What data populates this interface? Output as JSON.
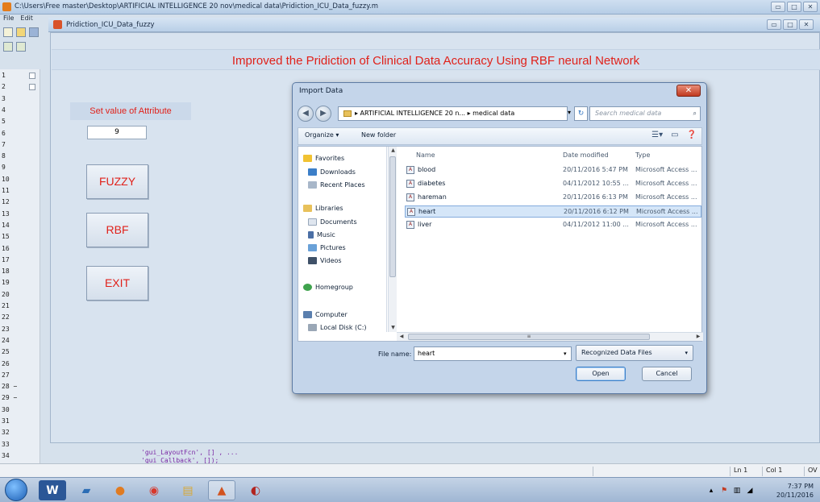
{
  "editor": {
    "title": "C:\\Users\\Free master\\Desktop\\ARTIFICIAL INTELLIGENCE 20 nov\\medical data\\Pridiction_ICU_Data_fuzzy.m",
    "menu": [
      "File",
      "Edit"
    ],
    "line_numbers": [
      "1",
      "2",
      "3",
      "4",
      "5",
      "6",
      "7",
      "8",
      "9",
      "10",
      "11",
      "12",
      "13",
      "14",
      "15",
      "16",
      "17",
      "18",
      "19",
      "20",
      "21",
      "22",
      "23",
      "24",
      "25",
      "26",
      "27",
      "28 −",
      "29 −",
      "30",
      "31",
      "32",
      "33",
      "34"
    ],
    "code_lines": [
      "'gui_LayoutFcn',  [] , ...",
      "'gui_Callback',   []);"
    ],
    "status": {
      "ln": "Ln 1",
      "col": "Col 1",
      "ovr": "OV"
    }
  },
  "gui": {
    "window_title": "Pridiction_ICU_Data_fuzzy",
    "heading": "Improved the Pridiction of Clinical Data Accuracy Using RBF neural Network",
    "attribute_label": "Set value of Attribute",
    "attribute_value": "9",
    "buttons": {
      "fuzzy": "FUZZY",
      "rbf": "RBF",
      "exit": "EXIT"
    }
  },
  "dialog": {
    "title": "Import Data",
    "address": "▸ ARTIFICIAL INTELLIGENCE 20 n... ▸ medical data",
    "search_placeholder": "Search medical data",
    "organize": "Organize ▾",
    "new_folder": "New folder",
    "nav": {
      "favorites": "Favorites",
      "downloads": "Downloads",
      "recent": "Recent Places",
      "libraries": "Libraries",
      "documents": "Documents",
      "music": "Music",
      "pictures": "Pictures",
      "videos": "Videos",
      "homegroup": "Homegroup",
      "computer": "Computer",
      "local_disk": "Local Disk (C:)"
    },
    "columns": {
      "name": "Name",
      "date": "Date modified",
      "type": "Type"
    },
    "files": [
      {
        "name": "blood",
        "date": "20/11/2016 5:47 PM",
        "type": "Microsoft Access ..."
      },
      {
        "name": "diabetes",
        "date": "04/11/2012 10:55 ...",
        "type": "Microsoft Access ..."
      },
      {
        "name": "hareman",
        "date": "20/11/2016 6:13 PM",
        "type": "Microsoft Access ..."
      },
      {
        "name": "heart",
        "date": "20/11/2016 6:12 PM",
        "type": "Microsoft Access ..."
      },
      {
        "name": "liver",
        "date": "04/11/2012 11:00 ...",
        "type": "Microsoft Access ..."
      }
    ],
    "selected_file_index": 3,
    "file_name_label": "File name:",
    "file_name_value": "heart",
    "file_type": "Recognized Data Files",
    "open": "Open",
    "cancel": "Cancel"
  },
  "taskbar": {
    "time": "7:37 PM",
    "date": "20/11/2016"
  },
  "colors": {
    "heading_red": "#e0211a",
    "selection": "#d5e6f8"
  }
}
